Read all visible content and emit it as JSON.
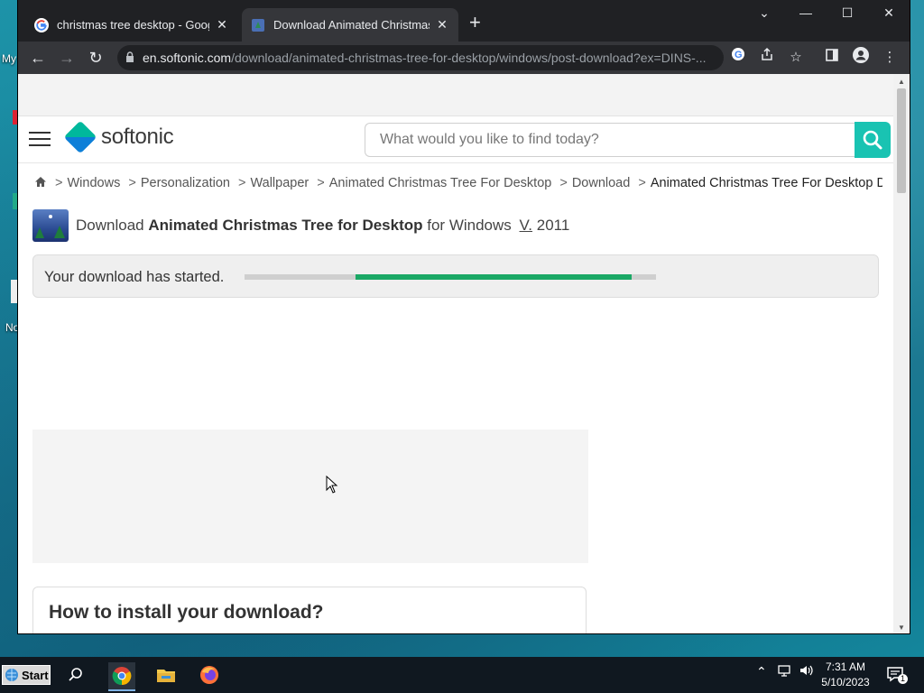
{
  "desktop": {
    "icon_labels": [
      "My",
      "No"
    ]
  },
  "browser": {
    "tabs": [
      {
        "title": "christmas tree desktop - Google",
        "close": "✕"
      },
      {
        "title": "Download Animated Christmas T",
        "close": "✕"
      }
    ],
    "new_tab": "+",
    "window_controls": {
      "dropdown": "⌄",
      "minimize": "—",
      "maximize": "☐",
      "close": "✕"
    },
    "nav": {
      "back": "←",
      "forward": "→",
      "reload": "↻"
    },
    "url": {
      "host": "en.softonic.com",
      "path": "/download/animated-christmas-tree-for-desktop/windows/post-download?ex=DINS-..."
    }
  },
  "site": {
    "logo_text": "softonic",
    "search": {
      "placeholder": "What would you like to find today?"
    },
    "breadcrumb": {
      "separator": ">",
      "items": [
        "Windows",
        "Personalization",
        "Wallpaper",
        "Animated Christmas Tree For Desktop",
        "Download"
      ],
      "current": "Animated Christmas Tree For Desktop Download"
    },
    "app_line": {
      "prefix": "Download ",
      "app_name": "Animated Christmas Tree for Desktop",
      "suffix": " for Windows ",
      "version_label": "V.",
      "version": " 2011"
    },
    "download_status": {
      "text": "Your download has started.",
      "progress_start": 0.27,
      "progress_end": 0.94
    },
    "install": {
      "title": "How to install your download?"
    }
  },
  "taskbar": {
    "start_label": "Start",
    "time": "7:31 AM",
    "date": "5/10/2023",
    "notification_count": "1"
  },
  "colors": {
    "accent": "#19c3b2",
    "progress": "#1aa865",
    "tab_bar": "#202124",
    "toolbar": "#35363a"
  }
}
